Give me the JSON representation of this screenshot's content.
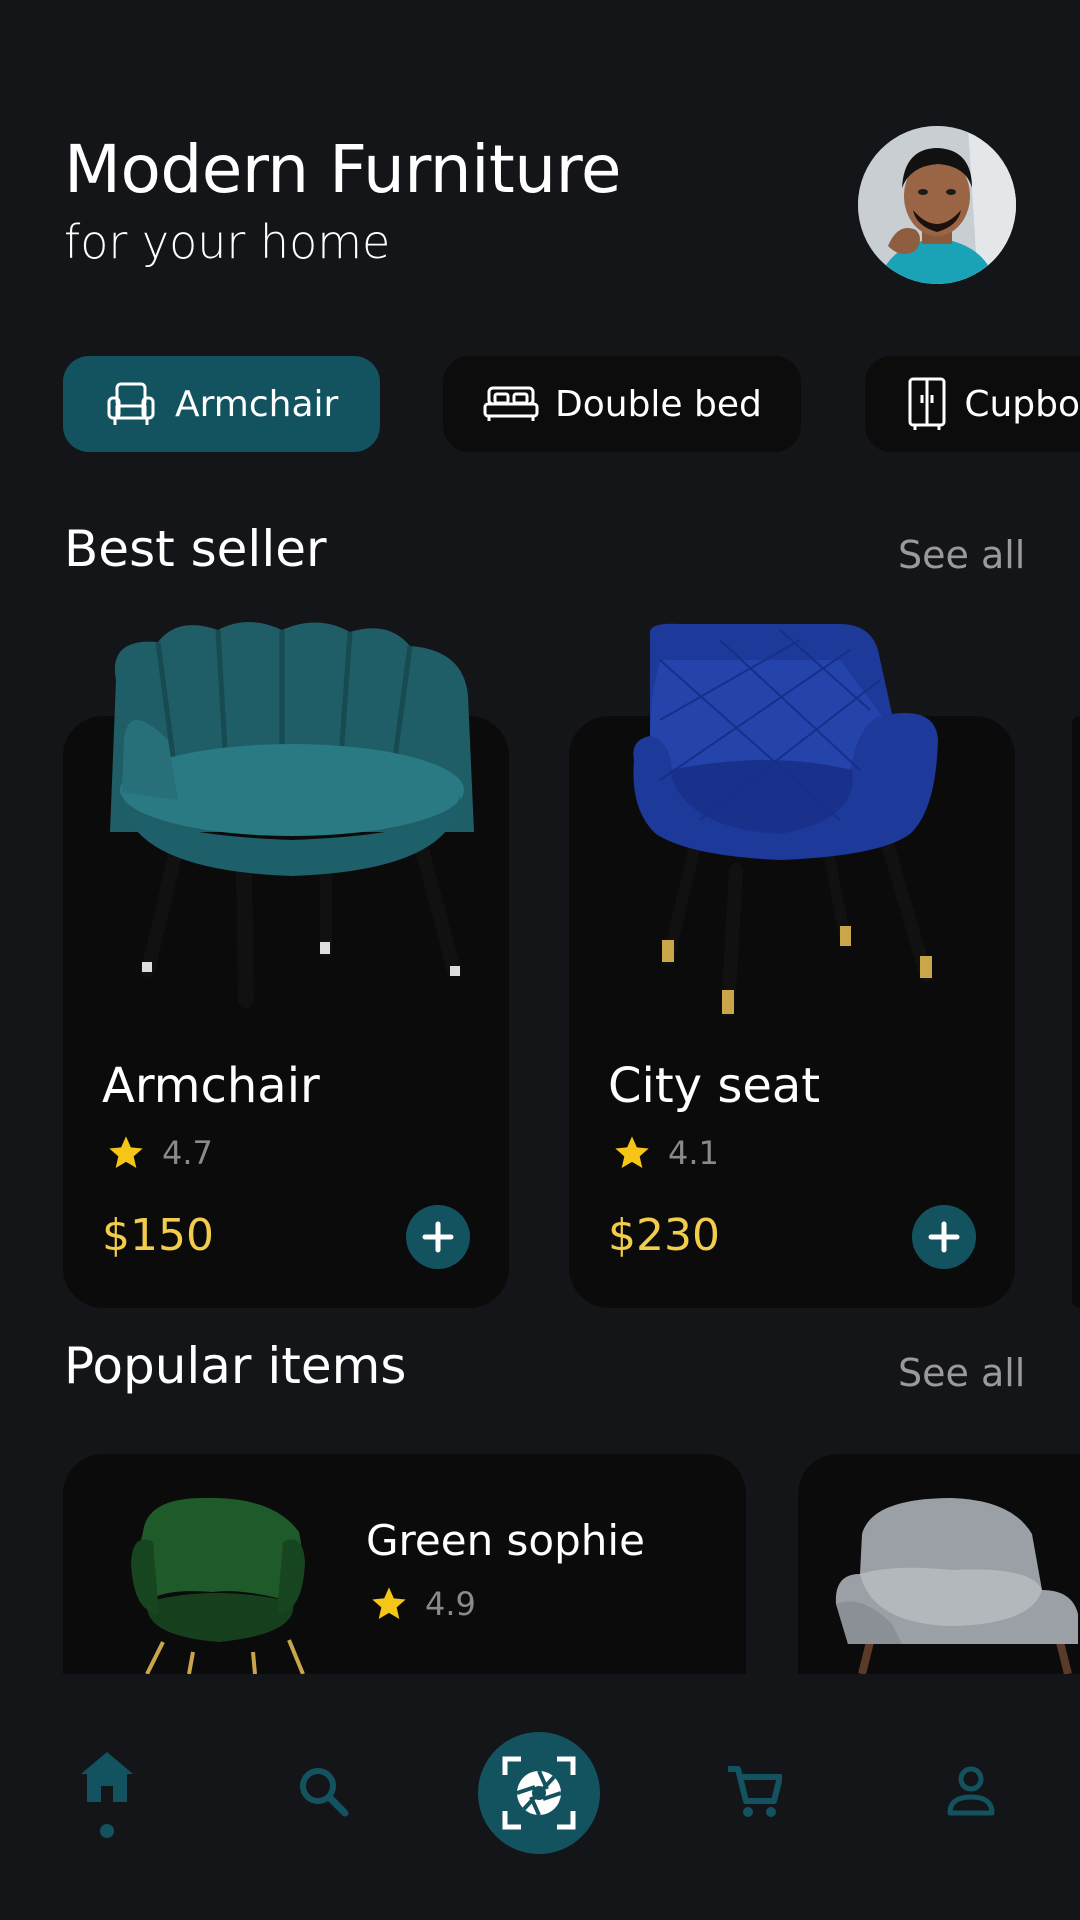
{
  "header": {
    "title": "Modern Furniture",
    "subtitle": "for your home"
  },
  "categories": [
    {
      "label": "Armchair",
      "icon": "armchair-icon",
      "active": true
    },
    {
      "label": "Double bed",
      "icon": "bed-icon",
      "active": false
    },
    {
      "label": "Cupbo",
      "icon": "cupboard-icon",
      "active": false
    }
  ],
  "best_seller": {
    "title": "Best seller",
    "see_all": "See all",
    "items": [
      {
        "name": "Armchair",
        "rating": "4.7",
        "price": "$150"
      },
      {
        "name": "City seat",
        "rating": "4.1",
        "price": "$230"
      }
    ]
  },
  "popular": {
    "title": "Popular items",
    "see_all": "See all",
    "items": [
      {
        "name": "Green sophie",
        "rating": "4.9"
      }
    ]
  },
  "nav": {
    "items": [
      "home-icon",
      "search-icon",
      "scan-icon",
      "cart-icon",
      "profile-icon"
    ],
    "active": "home"
  },
  "colors": {
    "background": "#141518",
    "card": "#0b0b0c",
    "accent": "#13535f",
    "price": "#f1cd4b",
    "star": "#f5c518"
  }
}
